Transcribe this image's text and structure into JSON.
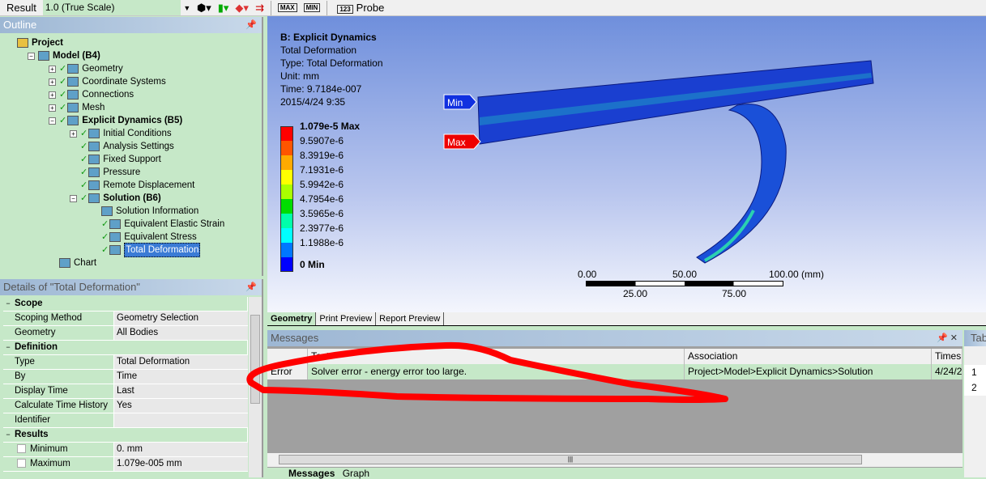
{
  "toolbar": {
    "result_label": "Result",
    "scale_value": "1.0 (True Scale)",
    "max_label": "MAX",
    "min_label": "MIN",
    "probe_label": "Probe",
    "probe_icon": "123"
  },
  "outline": {
    "title": "Outline",
    "items": [
      {
        "label": "Project",
        "level": 0,
        "bold": true,
        "exp": ""
      },
      {
        "label": "Model (B4)",
        "level": 1,
        "bold": true,
        "exp": "-"
      },
      {
        "label": "Geometry",
        "level": 2,
        "exp": "+",
        "check": true
      },
      {
        "label": "Coordinate Systems",
        "level": 2,
        "exp": "+",
        "check": true
      },
      {
        "label": "Connections",
        "level": 2,
        "exp": "+",
        "check": true
      },
      {
        "label": "Mesh",
        "level": 2,
        "exp": "+",
        "check": true
      },
      {
        "label": "Explicit Dynamics (B5)",
        "level": 2,
        "bold": true,
        "exp": "-",
        "check": true
      },
      {
        "label": "Initial Conditions",
        "level": 3,
        "exp": "+",
        "check": true
      },
      {
        "label": "Analysis Settings",
        "level": 3,
        "exp": "",
        "check": true
      },
      {
        "label": "Fixed Support",
        "level": 3,
        "exp": "",
        "check": true
      },
      {
        "label": "Pressure",
        "level": 3,
        "exp": "",
        "check": true
      },
      {
        "label": "Remote Displacement",
        "level": 3,
        "exp": "",
        "check": true
      },
      {
        "label": "Solution (B6)",
        "level": 3,
        "bold": true,
        "exp": "-",
        "check": true
      },
      {
        "label": "Solution Information",
        "level": 4,
        "exp": ""
      },
      {
        "label": "Equivalent Elastic Strain",
        "level": 4,
        "exp": "",
        "check": true
      },
      {
        "label": "Equivalent Stress",
        "level": 4,
        "exp": "",
        "check": true
      },
      {
        "label": "Total Deformation",
        "level": 4,
        "exp": "",
        "check": true,
        "selected": true
      },
      {
        "label": "Chart",
        "level": 2,
        "exp": ""
      }
    ]
  },
  "details": {
    "title": "Details of \"Total Deformation\"",
    "rows": [
      {
        "section": "Scope"
      },
      {
        "k": "Scoping Method",
        "v": "Geometry Selection"
      },
      {
        "k": "Geometry",
        "v": "All Bodies"
      },
      {
        "section": "Definition"
      },
      {
        "k": "Type",
        "v": "Total Deformation"
      },
      {
        "k": "By",
        "v": "Time"
      },
      {
        "k": "Display Time",
        "v": "Last"
      },
      {
        "k": "Calculate Time History",
        "v": "Yes"
      },
      {
        "k": "Identifier",
        "v": ""
      },
      {
        "section": "Results"
      },
      {
        "k": "Minimum",
        "v": "0. mm",
        "cb": true
      },
      {
        "k": "Maximum",
        "v": "1.079e-005 mm",
        "cb": true
      }
    ]
  },
  "viewport": {
    "title": "B: Explicit Dynamics",
    "lines": [
      "Total Deformation",
      "Type: Total Deformation",
      "Unit: mm",
      "Time: 9.7184e-007",
      "2015/4/24 9:35"
    ],
    "min_tag": "Min",
    "max_tag": "Max",
    "legend": [
      {
        "v": "1.079e-5 Max",
        "c": "#ff0000"
      },
      {
        "v": "9.5907e-6",
        "c": "#ff5500"
      },
      {
        "v": "8.3919e-6",
        "c": "#ffaa00"
      },
      {
        "v": "7.1931e-6",
        "c": "#ffff00"
      },
      {
        "v": "5.9942e-6",
        "c": "#aaff00"
      },
      {
        "v": "4.7954e-6",
        "c": "#00dd00"
      },
      {
        "v": "3.5965e-6",
        "c": "#00ffaa"
      },
      {
        "v": "2.3977e-6",
        "c": "#00ffff"
      },
      {
        "v": "1.1988e-6",
        "c": "#0077ff"
      },
      {
        "v": "0 Min",
        "c": "#0000ff"
      }
    ],
    "scale_top": [
      "0.00",
      "50.00",
      "100.00 (mm)"
    ],
    "scale_bottom": [
      "25.00",
      "75.00"
    ]
  },
  "view_tabs": [
    "Geometry",
    "Print Preview",
    "Report Preview"
  ],
  "messages": {
    "title": "Messages",
    "headers": [
      "",
      "Text",
      "Association",
      "Times"
    ],
    "rows": [
      [
        "Error",
        "Solver error - energy error too large.",
        "Project>Model>Explicit Dynamics>Solution",
        "4/24/2"
      ]
    ],
    "tabs": [
      "Messages",
      "Graph"
    ]
  },
  "tabular": {
    "title": "Tab",
    "rows": [
      "1",
      "2"
    ]
  }
}
